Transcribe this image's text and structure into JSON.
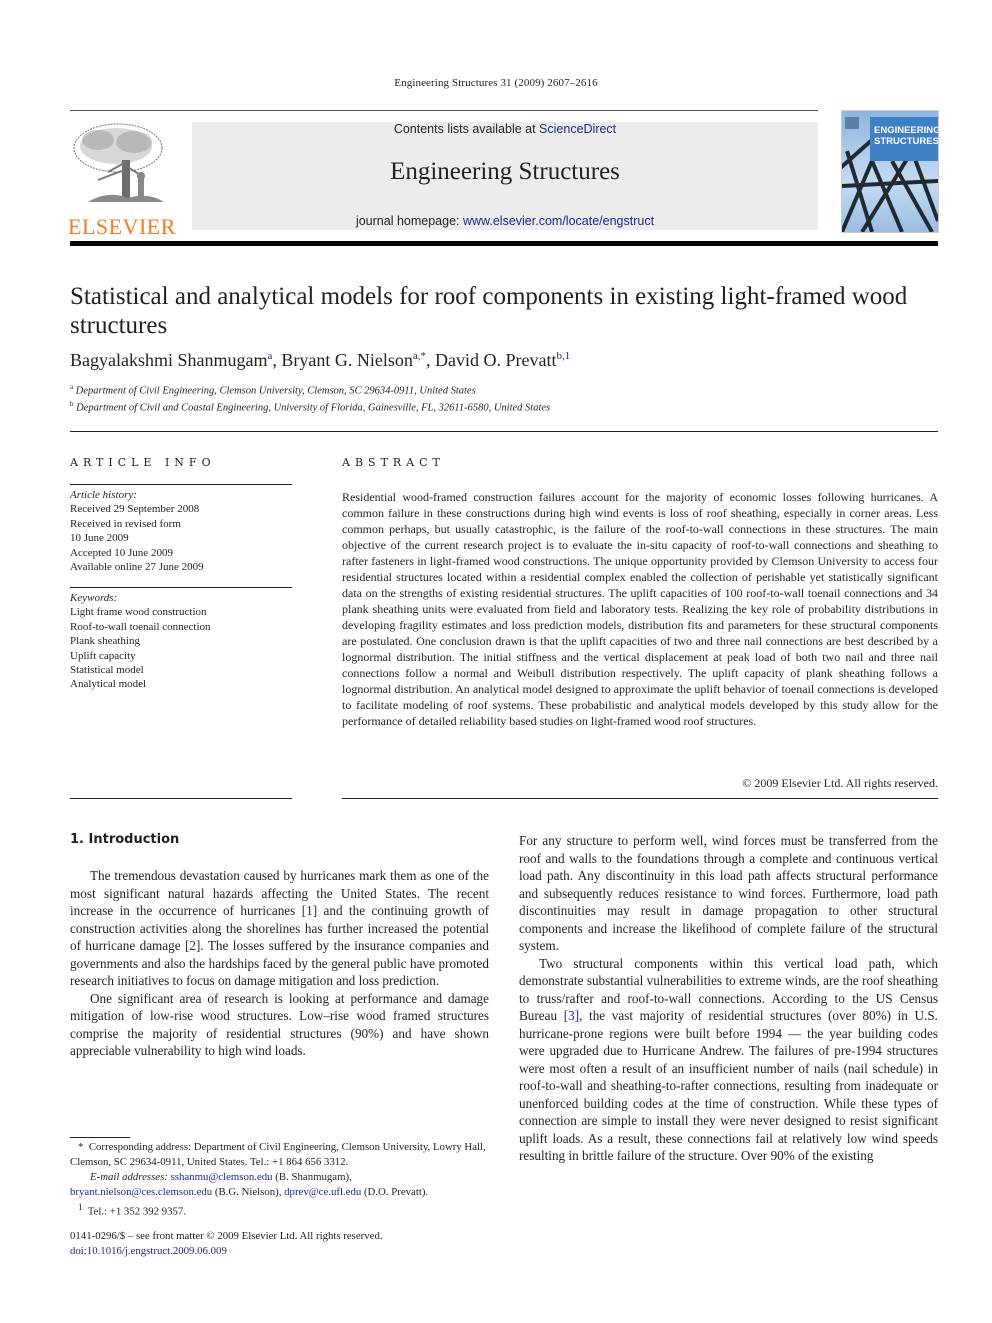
{
  "running_head": "Engineering Structures 31 (2009) 2607–2616",
  "header": {
    "publisher_logo_text": "ELSEVIER",
    "contents_prefix": "Contents lists available at ",
    "contents_link": "ScienceDirect",
    "journal_title": "Engineering Structures",
    "homepage_prefix": "journal homepage: ",
    "homepage_link": "www.elsevier.com/locate/engstruct",
    "cover_title_line1": "ENGINEERING",
    "cover_title_line2": "STRUCTURES"
  },
  "article": {
    "title": "Statistical and analytical models for roof components in existing light-framed wood structures",
    "authors": [
      {
        "name": "Bagyalakshmi Shanmugam",
        "sup": "a"
      },
      {
        "name": "Bryant G. Nielson",
        "sup": "a,*"
      },
      {
        "name": "David O. Prevatt",
        "sup": "b,1"
      }
    ],
    "affiliations": [
      {
        "sup": "a",
        "text": "Department of Civil Engineering, Clemson University, Clemson, SC 29634-0911, United States"
      },
      {
        "sup": "b",
        "text": "Department of Civil and Coastal Engineering, University of Florida, Gainesville, FL, 32611-6580, United States"
      }
    ]
  },
  "article_info": {
    "heading": "ARTICLE INFO",
    "history_label": "Article history:",
    "history": [
      "Received 29 September 2008",
      "Received in revised form",
      "10 June 2009",
      "Accepted 10 June 2009",
      "Available online 27 June 2009"
    ],
    "keywords_label": "Keywords:",
    "keywords": [
      "Light frame wood construction",
      "Roof-to-wall toenail connection",
      "Plank sheathing",
      "Uplift capacity",
      "Statistical model",
      "Analytical model"
    ]
  },
  "abstract": {
    "heading": "ABSTRACT",
    "text": "Residential wood-framed construction failures account for the majority of economic losses following hurricanes. A common failure in these constructions during high wind events is loss of roof sheathing, especially in corner areas. Less common perhaps, but usually catastrophic, is the failure of the roof-to-wall connections in these structures. The main objective of the current research project is to evaluate the in-situ capacity of roof-to-wall connections and sheathing to rafter fasteners in light-framed wood constructions. The unique opportunity provided by Clemson University to access four residential structures located within a residential complex enabled the collection of perishable yet statistically significant data on the strengths of existing residential structures. The uplift capacities of 100 roof-to-wall toenail connections and 34 plank sheathing units were evaluated from field and laboratory tests. Realizing the key role of probability distributions in developing fragility estimates and loss prediction models, distribution fits and parameters for these structural components are postulated. One conclusion drawn is that the uplift capacities of two and three nail connections are best described by a lognormal distribution. The initial stiffness and the vertical displacement at peak load of both two nail and three nail connections follow a normal and Weibull distribution respectively. The uplift capacity of plank sheathing follows a lognormal distribution. An analytical model designed to approximate the uplift behavior of toenail connections is developed to facilitate modeling of roof systems. These probabilistic and analytical models developed by this study allow for the performance of detailed reliability based studies on light-framed wood roof structures.",
    "copyright": "© 2009 Elsevier Ltd. All rights reserved."
  },
  "body": {
    "section_heading": "1.  Introduction",
    "left_paragraphs": [
      {
        "parts": [
          "The tremendous devastation caused by hurricanes mark them as one of the most significant natural hazards affecting the United States. The recent increase in the occurrence of hurricanes ",
          "[1]",
          " and the continuing growth of construction activities along the shorelines has further increased the potential of hurricane damage ",
          "[2]",
          ". The losses suffered by the insurance companies and governments and also the hardships faced by the general public have promoted research initiatives to focus on damage mitigation and loss prediction."
        ]
      },
      {
        "parts": [
          "One significant area of research is looking at performance and damage mitigation of low-rise wood structures. Low–rise wood framed structures comprise the majority of residential structures (90%) and have shown appreciable vulnerability to high wind loads."
        ]
      }
    ],
    "right_paragraphs": [
      {
        "parts": [
          "For any structure to perform well, wind forces must be transferred from the roof and walls to the foundations through a complete and continuous vertical load path. Any discontinuity in this load path affects structural performance and subsequently reduces resistance to wind forces. Furthermore, load path discontinuities may result in damage propagation to other structural components and increase the likelihood of complete failure of the structural system."
        ]
      },
      {
        "parts": [
          "Two structural components within this vertical load path, which demonstrate substantial vulnerabilities to extreme winds, are the roof sheathing to truss/rafter and roof-to-wall connections. According to the US Census Bureau ",
          "[3]",
          ", the vast majority of residential structures (over 80%) in U.S. hurricane-prone regions were built before 1994 — the year building codes were upgraded due to Hurricane Andrew. The failures of pre-1994 structures were most often a result of an insufficient number of nails (nail schedule) in roof-to-wall and sheathing-to-rafter connections, resulting from inadequate or unenforced building codes at the time of construction. While these types of connection are simple to install they were never designed to resist significant uplift loads. As a result, these connections fail at relatively low wind speeds resulting in brittle failure of the structure. Over 90% of the existing"
        ]
      }
    ]
  },
  "footnotes": {
    "corresponding_mark": "*",
    "corresponding": "Corresponding address: Department of Civil Engineering, Clemson University, Lowry Hall, Clemson, SC 29634-0911, United States. Tel.: +1 864 656 3312.",
    "email_label": "E-mail addresses:",
    "emails": [
      {
        "address": "sshanmu@clemson.edu",
        "owner": "(B. Shanmugam),"
      },
      {
        "address": "bryant.nielson@ces.clemson.edu",
        "owner": "(B.G. Nielson),"
      },
      {
        "address": "dprev@ce.ufl.edu",
        "owner": "(D.O. Prevatt)."
      }
    ],
    "tel_mark": "1",
    "tel": "Tel.: +1 352 392 9357.",
    "issn": "0141-0296/$ – see front matter © 2009 Elsevier Ltd. All rights reserved.",
    "doi": "doi:10.1016/j.engstruct.2009.06.009"
  }
}
